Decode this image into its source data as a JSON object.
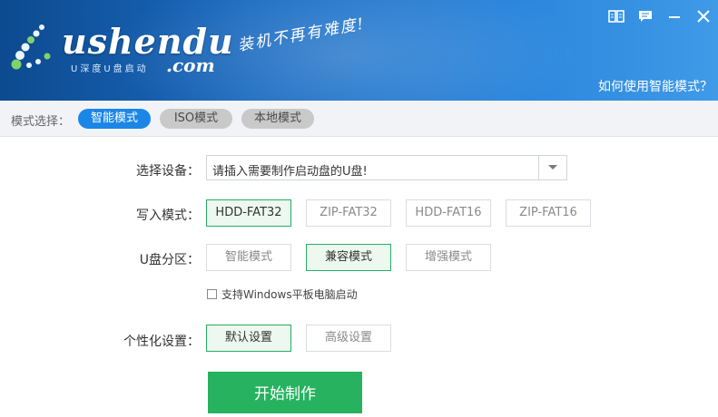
{
  "header": {
    "logo_text": "ushendu",
    "logo_com": ".com",
    "logo_sub": "U深度U盘启动",
    "slogan": "装机不再有难度!",
    "help_link": "如何使用智能模式？",
    "brand_color": "#1a6ac0"
  },
  "window_controls": {
    "icons": [
      "book-icon",
      "chat-icon",
      "minimize-icon",
      "close-icon"
    ]
  },
  "modebar": {
    "label": "模式选择：",
    "tabs": [
      {
        "label": "智能模式",
        "active": true
      },
      {
        "label": "ISO模式",
        "active": false
      },
      {
        "label": "本地模式",
        "active": false
      }
    ],
    "accent_color": "#1b86e8"
  },
  "form": {
    "device_label": "选择设备：",
    "device_value": "请插入需要制作启动盘的U盘!",
    "write_mode_label": "写入模式：",
    "write_modes": [
      {
        "label": "HDD-FAT32",
        "selected": true
      },
      {
        "label": "ZIP-FAT32",
        "selected": false
      },
      {
        "label": "HDD-FAT16",
        "selected": false
      },
      {
        "label": "ZIP-FAT16",
        "selected": false
      }
    ],
    "partition_label": "U盘分区：",
    "partition_modes": [
      {
        "label": "智能模式",
        "selected": false
      },
      {
        "label": "兼容模式",
        "selected": true
      },
      {
        "label": "增强模式",
        "selected": false
      }
    ],
    "tablet_checkbox_label": "支持Windows平板电脑启动",
    "tablet_checked": false,
    "personalize_label": "个性化设置：",
    "personalize_options": [
      {
        "label": "默认设置",
        "selected": true
      },
      {
        "label": "高级设置",
        "selected": false
      }
    ],
    "start_button": "开始制作",
    "selected_color": "#27ad63"
  }
}
